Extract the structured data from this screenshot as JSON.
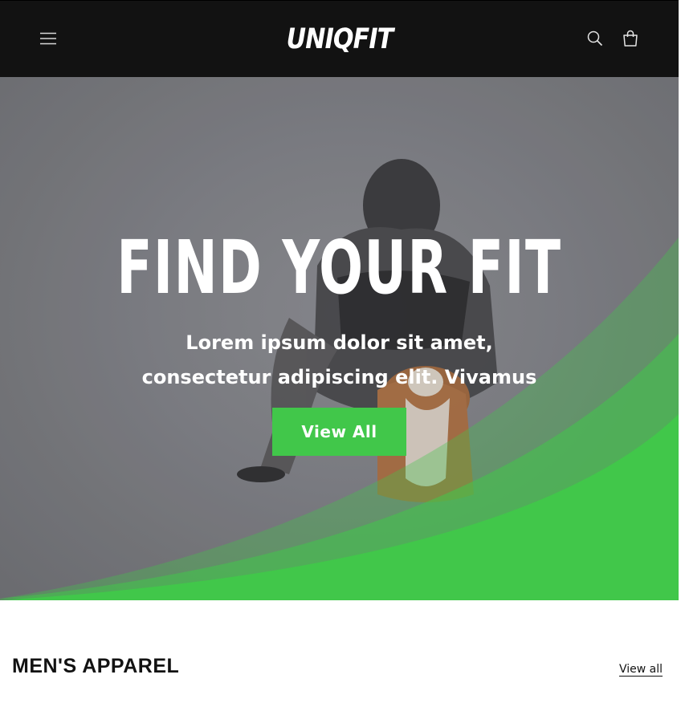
{
  "header": {
    "logo_text": "UNIQFIT",
    "icons": [
      "menu-icon",
      "search-icon",
      "cart-icon"
    ]
  },
  "hero": {
    "title": "FIND YOUR FIT",
    "subtitle": "Lorem ipsum dolor sit amet, consectetur adipiscing elit. Vivamus",
    "button_label": "View All",
    "accent_color": "#41c74a",
    "image": "man-with-corgi-photo"
  },
  "collection": {
    "title": "MEN'S APPAREL",
    "view_all_label": "View all"
  }
}
